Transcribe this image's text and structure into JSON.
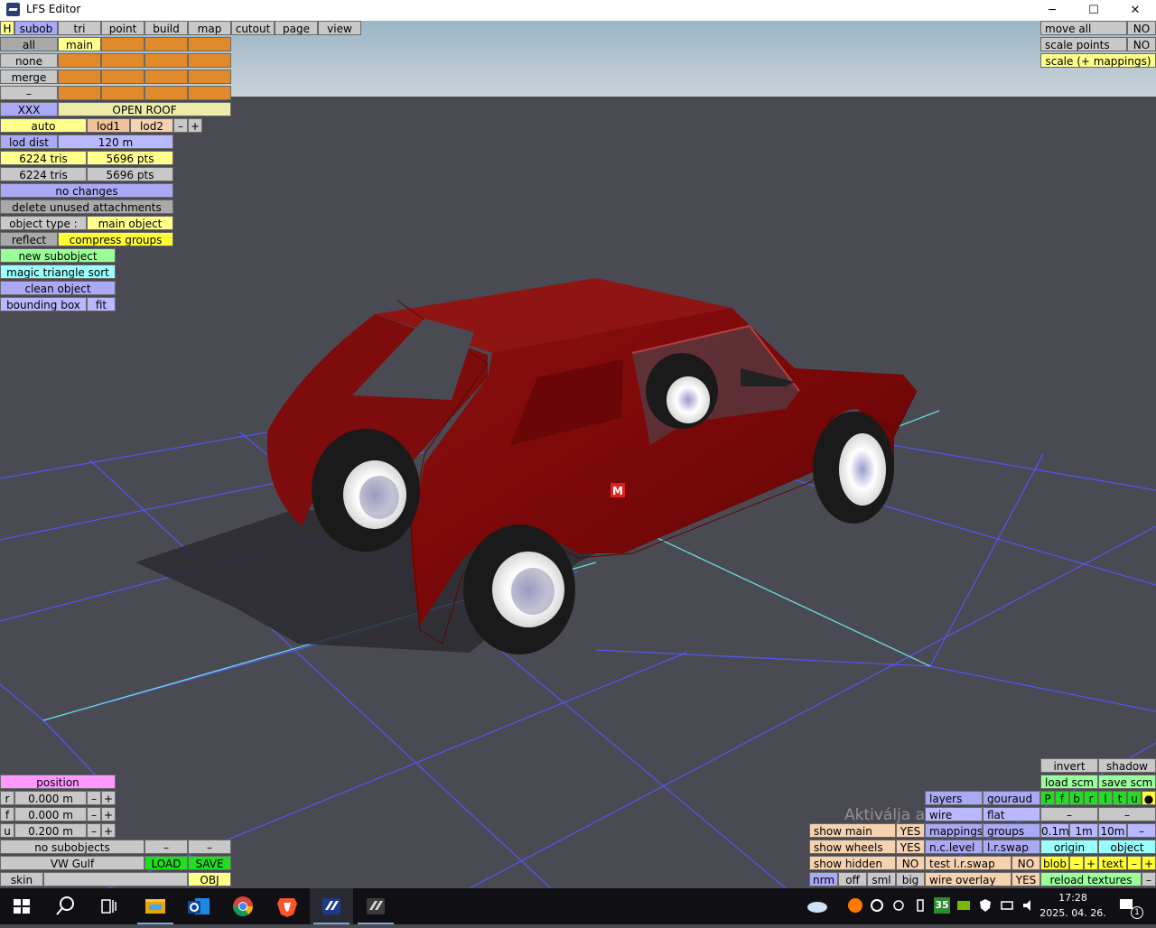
{
  "window": {
    "title": "LFS Editor",
    "minimize": "─",
    "maximize": "☐",
    "close": "✕"
  },
  "top_menu": {
    "h": "H",
    "tabs": [
      "subob",
      "tri",
      "point",
      "build",
      "map",
      "cutout",
      "page",
      "view"
    ]
  },
  "subobject_panel": {
    "all": "all",
    "main": "main",
    "none": "none",
    "merge": "merge",
    "dash": "–",
    "xxx": "XXX",
    "open_roof": "OPEN ROOF",
    "auto": "auto",
    "lod1": "lod1",
    "lod2": "lod2",
    "minus": "–",
    "plus": "+",
    "lod_dist_label": "lod dist",
    "lod_dist_value": "120 m",
    "tris1": "6224 tris",
    "pts1": "5696 pts",
    "tris2": "6224 tris",
    "pts2": "5696 pts",
    "no_changes": "no changes",
    "delete_unused": "delete unused attachments",
    "object_type_label": "object type :",
    "object_type_value": "main object",
    "reflect": "reflect",
    "compress_groups": "compress groups",
    "new_subobject": "new subobject",
    "magic_triangle_sort": "magic triangle sort",
    "clean_object": "clean object",
    "bounding_box": "bounding box",
    "fit": "fit"
  },
  "top_right": {
    "move_all": "move all",
    "move_all_val": "NO",
    "scale_points": "scale points",
    "scale_points_val": "NO",
    "scale_mappings": "scale (+ mappings)"
  },
  "position_panel": {
    "title": "position",
    "rows": [
      {
        "axis": "r",
        "value": "0.000 m"
      },
      {
        "axis": "f",
        "value": "0.000 m"
      },
      {
        "axis": "u",
        "value": "0.200 m"
      }
    ],
    "minus": "–",
    "plus": "+",
    "no_subobjects": "no subobjects",
    "car_name": "VW Gulf",
    "load": "LOAD",
    "save": "SAVE",
    "skin": "skin",
    "obj": "OBJ"
  },
  "bottom_right": {
    "invert": "invert",
    "shadow": "shadow",
    "load_scm": "load scm",
    "save_scm": "save scm",
    "letters": [
      "P",
      "f",
      "b",
      "r",
      "l",
      "t",
      "u",
      "●"
    ],
    "layers": "layers",
    "gouraud": "gouraud",
    "wire": "wire",
    "flat": "flat",
    "dash": "–",
    "show_main": "show main",
    "show_main_val": "YES",
    "mappings": "mappings",
    "groups": "groups",
    "d01": "0.1m",
    "d1": "1m",
    "d10": "10m",
    "show_wheels": "show wheels",
    "show_wheels_val": "YES",
    "nc_level": "n.c.level",
    "lr_swap": "l.r.swap",
    "origin": "origin",
    "object": "object",
    "show_hidden": "show hidden",
    "show_hidden_val": "NO",
    "test_lr_swap": "test l.r.swap",
    "test_lr_swap_val": "NO",
    "blob": "blob",
    "text": "text",
    "minus": "–",
    "plus": "+",
    "nrm": "nrm",
    "off": "off",
    "sml": "sml",
    "big": "big",
    "wire_overlay": "wire overlay",
    "wire_overlay_val": "YES",
    "reload_textures": "reload textures"
  },
  "watermark": "Aktiválja a Windowst",
  "decal": "M",
  "taskbar": {
    "icons": [
      "start-icon",
      "search-icon",
      "task-view-icon",
      "file-explorer-icon",
      "outlook-icon",
      "chrome-icon",
      "brave-icon",
      "lfs-icon",
      "lfs-editor-icon"
    ],
    "tray_num": "35",
    "time": "17:28",
    "date": "2025. 04. 26.",
    "notif_count": "1"
  }
}
